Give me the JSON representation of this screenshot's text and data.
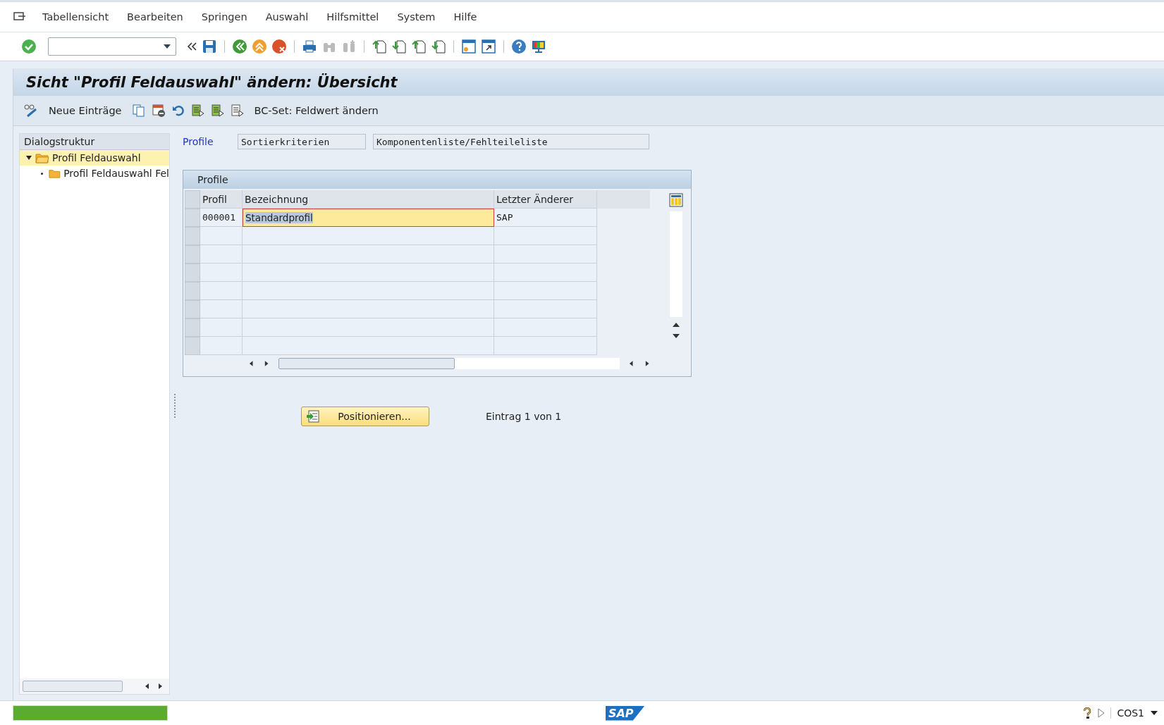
{
  "menu": [
    "Tabellensicht",
    "Bearbeiten",
    "Springen",
    "Auswahl",
    "Hilfsmittel",
    "System",
    "Hilfe"
  ],
  "title": "Sicht \"Profil Feldauswahl\" ändern: Übersicht",
  "app_toolbar": {
    "new_entries": "Neue Einträge",
    "bc_set": "BC-Set: Feldwert ändern"
  },
  "dialog_structure": {
    "title": "Dialogstruktur",
    "items": [
      {
        "label": "Profil Feldauswahl",
        "selected": true,
        "expanded": true,
        "children": [
          {
            "label": "Profil Feldauswahl Fel",
            "selected": false
          }
        ]
      }
    ]
  },
  "header_fields": {
    "label": "Profile",
    "values": [
      "Sortierkriterien",
      "Komponentenliste/Fehlteileliste"
    ]
  },
  "table": {
    "title": "Profile",
    "columns": [
      "Profil",
      "Bezeichnung",
      "Letzter Änderer"
    ],
    "rows": [
      {
        "cells": [
          {
            "text": "000001",
            "focused": false
          },
          {
            "text": "Standardprofil",
            "focused": true
          },
          {
            "text": "SAP",
            "focused": false
          }
        ]
      }
    ]
  },
  "position_button": "Positionieren...",
  "entry_count": "Eintrag 1 von 1",
  "status_bar": {
    "progress": {
      "level": 1
    },
    "logo": "SAP",
    "system": "COS1"
  }
}
